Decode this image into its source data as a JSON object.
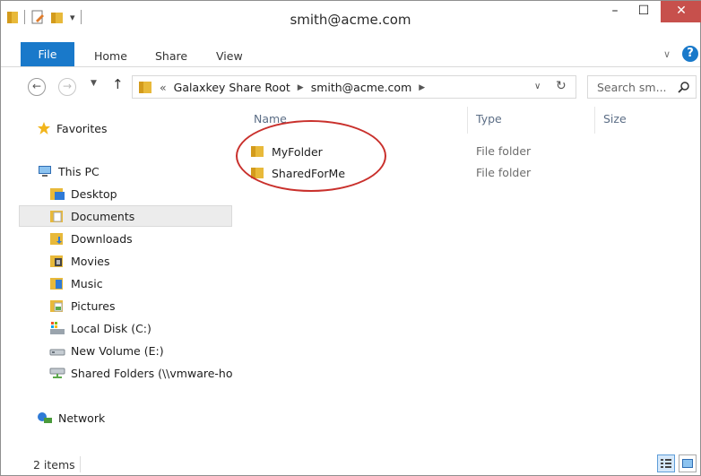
{
  "window": {
    "title": "smith@acme.com",
    "controls": {
      "minimize": "–",
      "maximize": "☐",
      "close": "✕"
    }
  },
  "ribbon": {
    "tabs": [
      {
        "label": "File",
        "active": true
      },
      {
        "label": "Home"
      },
      {
        "label": "Share"
      },
      {
        "label": "View"
      }
    ],
    "help": "?"
  },
  "address_bar": {
    "prefix": "«",
    "crumbs": [
      "Galaxkey Share Root",
      "smith@acme.com"
    ],
    "search_placeholder": "Search sm..."
  },
  "sidebar": {
    "favorites": "Favorites",
    "this_pc": "This PC",
    "items": [
      {
        "label": "Desktop",
        "icon": "desktop-folder-icon"
      },
      {
        "label": "Documents",
        "icon": "documents-folder-icon",
        "selected": true
      },
      {
        "label": "Downloads",
        "icon": "downloads-folder-icon"
      },
      {
        "label": "Movies",
        "icon": "movies-folder-icon"
      },
      {
        "label": "Music",
        "icon": "music-folder-icon"
      },
      {
        "label": "Pictures",
        "icon": "pictures-folder-icon"
      },
      {
        "label": "Local Disk (C:)",
        "icon": "local-disk-icon"
      },
      {
        "label": "New Volume (E:)",
        "icon": "drive-icon"
      },
      {
        "label": "Shared Folders (\\\\vmware-ho",
        "icon": "network-drive-icon"
      }
    ],
    "network": "Network"
  },
  "file_list": {
    "columns": [
      "Name",
      "Type",
      "Size"
    ],
    "rows": [
      {
        "name": "MyFolder",
        "type": "File folder"
      },
      {
        "name": "SharedForMe",
        "type": "File folder"
      }
    ],
    "highlight_color": "#c9302c"
  },
  "status_bar": {
    "text": "2 items"
  },
  "colors": {
    "accent": "#1979ca",
    "folder": "#e8b93a",
    "close": "#c7504c"
  }
}
